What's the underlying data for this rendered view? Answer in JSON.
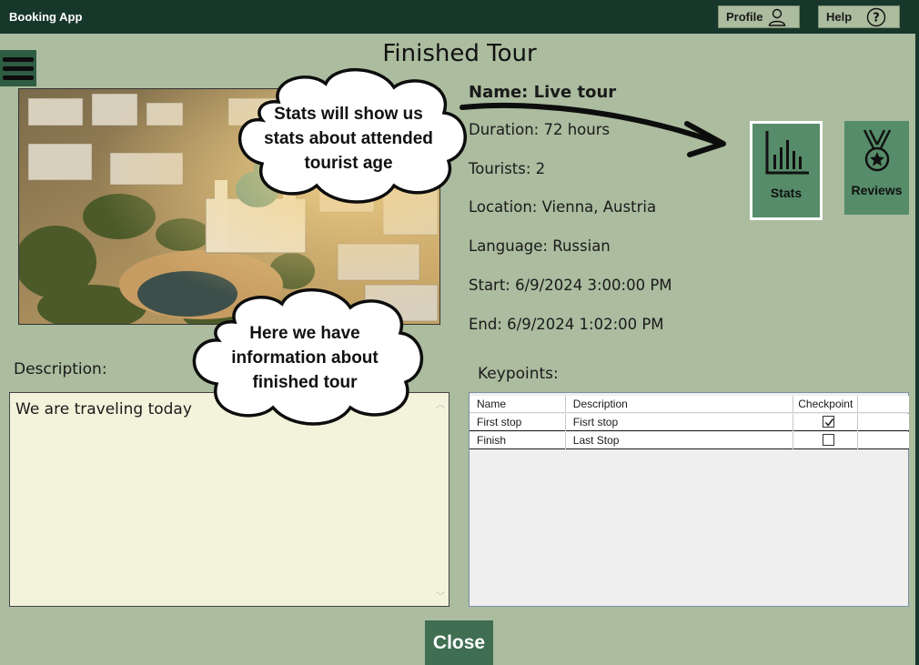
{
  "app": {
    "title": "Booking App"
  },
  "header": {
    "profile_label": "Profile",
    "help_label": "Help",
    "profile_icon": "user-icon",
    "help_icon": "question-circle-icon"
  },
  "menu": {
    "icon": "hamburger-menu-icon"
  },
  "page": {
    "title": "Finished Tour"
  },
  "tour": {
    "name": "Name: Live tour",
    "duration": "Duration: 72 hours",
    "tourists": "Tourists: 2",
    "location": "Location: Vienna, Austria",
    "language": "Language: Russian",
    "start": "Start: 6/9/2024 3:00:00 PM",
    "end": "End: 6/9/2024 1:02:00 PM"
  },
  "actions": {
    "stats_label": "Stats",
    "reviews_label": "Reviews",
    "stats_icon": "bar-chart-icon",
    "reviews_icon": "medal-icon",
    "close_label": "Close"
  },
  "description": {
    "label": "Description:",
    "text": "We are traveling today"
  },
  "keypoints": {
    "label": "Keypoints:",
    "columns": [
      "Name",
      "Description",
      "Checkpoint"
    ],
    "rows": [
      {
        "name": "First stop",
        "description": "Fisrt stop",
        "checkpoint": true
      },
      {
        "name": "Finish",
        "description": "Last Stop",
        "checkpoint": false
      }
    ]
  },
  "annotations": {
    "stats_callout": [
      "Stats will show us",
      "stats about attended",
      "tourist age"
    ],
    "info_callout": [
      "Here we have",
      "information about",
      "finished tour"
    ]
  },
  "colors": {
    "topbar": "#17372b",
    "background": "#abbc9f",
    "button_green": "#568c69",
    "close_button": "#3f6e52",
    "description_bg": "#f3f3dc"
  }
}
